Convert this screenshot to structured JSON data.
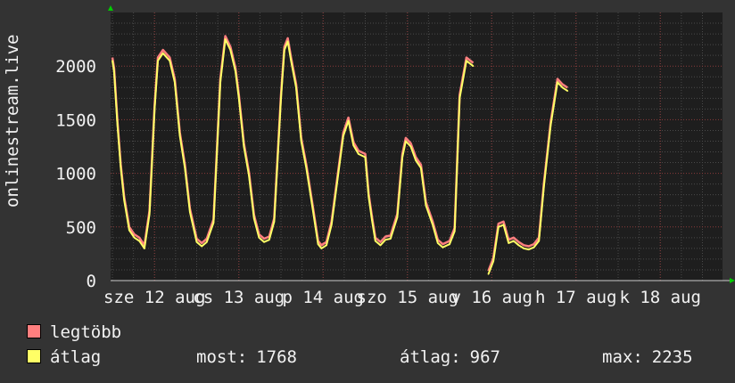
{
  "chart_data": {
    "type": "line",
    "ylabel": "onlinestream.live",
    "ylim": [
      0,
      2500
    ],
    "yticks": [
      0,
      500,
      1000,
      1500,
      2000
    ],
    "grid": true,
    "xticks": [
      "sze 12 aug",
      "cs 13 aug",
      "p 14 aug",
      "szo 15 aug",
      "v 16 aug",
      "h 17 aug",
      "k 18 aug"
    ],
    "series": [
      {
        "name": "legtöbb",
        "color": "#ff7f7f"
      },
      {
        "name": "átlag",
        "color": "#ffff66"
      }
    ],
    "x": [
      0,
      0.02,
      0.06,
      0.1,
      0.14,
      0.2,
      0.26,
      0.32,
      0.38,
      0.44,
      0.5,
      0.54,
      0.6,
      0.68,
      0.74,
      0.8,
      0.86,
      0.92,
      1.0,
      1.06,
      1.12,
      1.2,
      1.28,
      1.34,
      1.4,
      1.46,
      1.5,
      1.56,
      1.62,
      1.68,
      1.74,
      1.8,
      1.86,
      1.92,
      2.0,
      2.04,
      2.08,
      2.12,
      2.18,
      2.24,
      2.3,
      2.38,
      2.44,
      2.48,
      2.54,
      2.6,
      2.68,
      2.74,
      2.8,
      2.86,
      2.92,
      3.0,
      3.04,
      3.08,
      3.12,
      3.18,
      3.24,
      3.3,
      3.38,
      3.44,
      3.48,
      3.54,
      3.6,
      3.66,
      3.72,
      3.8,
      3.86,
      3.92,
      4.0,
      4.06,
      4.12,
      4.2,
      4.28,
      4.34,
      4.4,
      4.46,
      4.52,
      4.58,
      4.64,
      4.7,
      4.76,
      4.82,
      4.88,
      4.94,
      5.0,
      5.06,
      5.12,
      5.2,
      5.28,
      5.34,
      5.4,
      5.46,
      5.52,
      5.58,
      5.64,
      5.7,
      5.78,
      5.84,
      5.88,
      5.92,
      5.96,
      6.0,
      6.04,
      6.08,
      6.12,
      6.16,
      6.2,
      6.24,
      6.28,
      6.32,
      6.36,
      6.4,
      6.46,
      6.52,
      6.58,
      6.64,
      6.72,
      6.78,
      6.84,
      6.9,
      6.96
    ],
    "values": [
      2050,
      1950,
      1450,
      1050,
      750,
      470,
      400,
      370,
      300,
      620,
      1600,
      2050,
      2120,
      2050,
      1850,
      1350,
      1050,
      640,
      360,
      320,
      360,
      540,
      1850,
      2250,
      2150,
      1950,
      1700,
      1250,
      980,
      580,
      400,
      360,
      380,
      550,
      1700,
      2150,
      2230,
      2050,
      1800,
      1300,
      1050,
      650,
      340,
      300,
      330,
      520,
      1000,
      1350,
      1490,
      1260,
      1180,
      1150,
      780,
      560,
      370,
      330,
      380,
      390,
      590,
      1150,
      1300,
      1250,
      1120,
      1050,
      700,
      520,
      350,
      310,
      340,
      460,
      1700,
      2050,
      2000,
      null,
      null,
      60,
      180,
      500,
      520,
      350,
      370,
      330,
      300,
      290,
      310,
      370,
      880,
      1450,
      1850,
      1800,
      1768
    ]
  },
  "legend": {
    "items": [
      {
        "label": "legtöbb",
        "color": "#ff7f7f"
      },
      {
        "label": "átlag",
        "color": "#ffff66"
      }
    ]
  },
  "stats": {
    "now_label": "most:",
    "now_value": "1768",
    "avg_label": "átlag:",
    "avg_value": "967",
    "max_label": "max:",
    "max_value": "2235"
  }
}
